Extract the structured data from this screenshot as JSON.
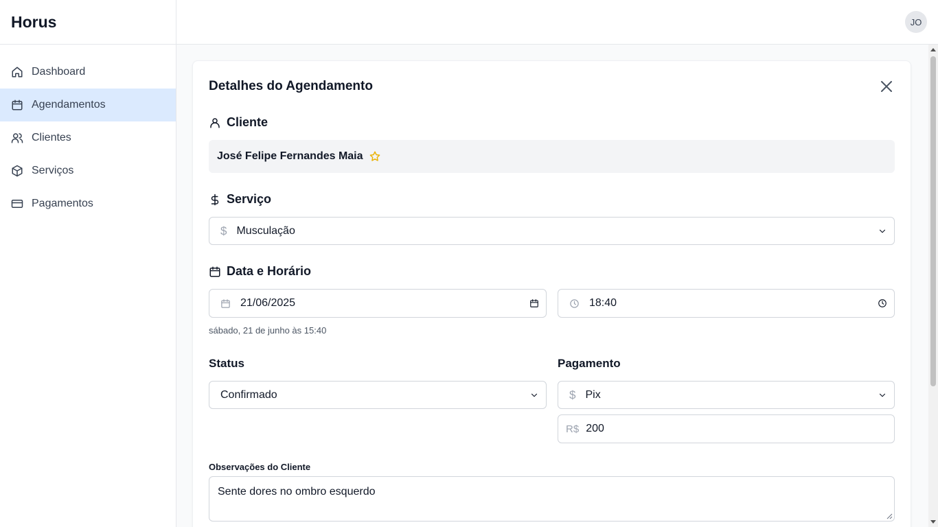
{
  "app": {
    "brand": "Horus",
    "user_initials": "JO"
  },
  "sidebar": {
    "items": [
      {
        "label": "Dashboard",
        "icon": "home-icon"
      },
      {
        "label": "Agendamentos",
        "icon": "calendar-icon",
        "active": true
      },
      {
        "label": "Clientes",
        "icon": "users-icon"
      },
      {
        "label": "Serviços",
        "icon": "package-icon"
      },
      {
        "label": "Pagamentos",
        "icon": "credit-card-icon"
      }
    ]
  },
  "dialog": {
    "title": "Detalhes do Agendamento",
    "cliente": {
      "heading": "Cliente",
      "name": "José Felipe Fernandes Maia"
    },
    "servico": {
      "heading": "Serviço",
      "selected": "Musculação",
      "prefix": "$"
    },
    "data_horario": {
      "heading": "Data e Horário",
      "date": "21/06/2025",
      "time": "18:40",
      "helper": "sábado, 21 de junho às 15:40"
    },
    "status": {
      "label": "Status",
      "selected": "Confirmado"
    },
    "pagamento": {
      "label": "Pagamento",
      "method": "Pix",
      "method_prefix": "$",
      "currency": "R$",
      "amount": "200"
    },
    "observacoes": {
      "label": "Observações do Cliente",
      "text": "Sente dores no ombro esquerdo"
    }
  },
  "colors": {
    "active_nav_bg": "#dbeafe",
    "star": "#eab308",
    "border": "#d1d5db"
  }
}
